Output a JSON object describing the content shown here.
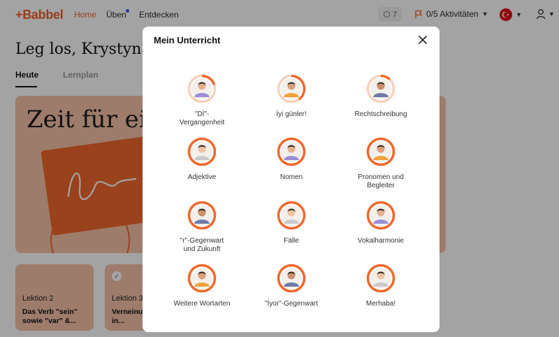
{
  "nav": {
    "logo": "+Babbel",
    "links": [
      "Home",
      "Üben",
      "Entdecken"
    ],
    "streak": "7",
    "activities": "0/5 Aktivitäten"
  },
  "page": {
    "greeting": "Leg los, Krystyna!",
    "tabs": [
      "Heute",
      "Lernplan"
    ],
    "hero_title": "Zeit für eine",
    "lessons": [
      {
        "label": "Lektion 2",
        "title": "Das Verb \"sein\" sowie \"var\" &..."
      },
      {
        "label": "Lektion 3",
        "title": "Verneinu... Fragen in..."
      }
    ]
  },
  "modal": {
    "title": "Mein Unterricht",
    "items": [
      {
        "label": "\"Dİ\"-\nVergangenheit",
        "progress": 0.2
      },
      {
        "label": "İyi günler!",
        "progress": 0.4
      },
      {
        "label": "Rechtschreibung",
        "progress": 0.12
      },
      {
        "label": "Adjektive",
        "progress": 1.0
      },
      {
        "label": "Nomen",
        "progress": 1.0
      },
      {
        "label": "Pronomen und\nBegleiter",
        "progress": 1.0
      },
      {
        "label": "\"r\"-Gegenwart\nund Zukunft",
        "progress": 1.0
      },
      {
        "label": "Fälle",
        "progress": 1.0
      },
      {
        "label": "Vokalharmonie",
        "progress": 1.0
      },
      {
        "label": "Weitere Wortarten",
        "progress": 1.0
      },
      {
        "label": "\"İyor\"-Gegenwart",
        "progress": 1.0
      },
      {
        "label": "Merhaba!",
        "progress": 1.0
      }
    ]
  },
  "colors": {
    "accent": "#f25f2a",
    "ring": "#f0682b",
    "ring_track": "#f7d1bd",
    "hero": "#f6c2a8"
  }
}
